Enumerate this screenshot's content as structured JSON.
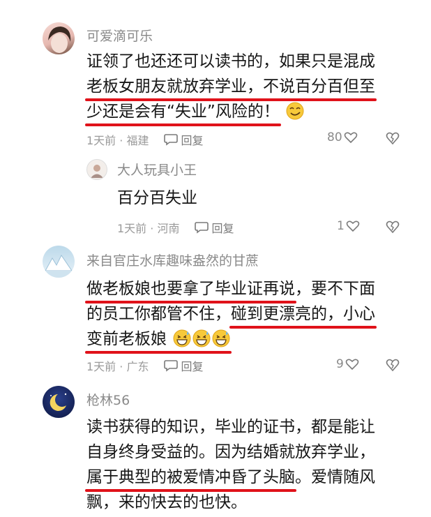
{
  "comments": [
    {
      "user": "可爱滴可乐",
      "lines": [
        {
          "plain": "证领了也还还可以读书的，如果只是混成",
          "ul": ""
        },
        {
          "ul": "老板女朋友就放弃学业，不说百分百但至",
          "plain": ""
        },
        {
          "ul": "少还是会有“失业”风险的！",
          "plain": ""
        }
      ],
      "time_place": "1天前 · 福建",
      "reply_label": "回复",
      "likes": "80",
      "reply": {
        "user": "大人玩具小王",
        "text": "百分百失业",
        "time_place": "1天前 · 河南",
        "reply_label": "回复",
        "likes": "1"
      }
    },
    {
      "user": "来自官庄水库趣味盎然的甘蔗",
      "lines": [
        {
          "ul": "做老板娘也要拿了毕业证再说",
          "plain": "，要不下面"
        },
        {
          "plain": "的员工你都管不住，",
          "ul": "碰到更漂亮的，小心"
        },
        {
          "ul": "变前老板娘",
          "plain": ""
        }
      ],
      "time_place": "1天前 · 广东",
      "reply_label": "回复",
      "likes": "9"
    },
    {
      "user": "枪林56",
      "lines": [
        {
          "plain": "读书获得的知识，毕业的证书，都是能让",
          "ul": ""
        },
        {
          "plain": "自身终身受益的。因为结婚就放弃学业，",
          "ul": ""
        },
        {
          "ul": "属于典型的被爱情冲昏了头脑",
          "plain": "。爱情随风"
        },
        {
          "plain": "飘，来的快去的也快。",
          "ul": ""
        }
      ]
    }
  ],
  "icons": {
    "reply": "speech-bubble-icon",
    "like": "heart-outline-icon",
    "dislike": "broken-heart-icon",
    "emoji_smirk": "smirk-emoji-icon",
    "emoji_sweat": "grin-sweat-emoji-icon"
  },
  "colors": {
    "underline": "#e0121a",
    "meta": "#9a9a9a"
  }
}
